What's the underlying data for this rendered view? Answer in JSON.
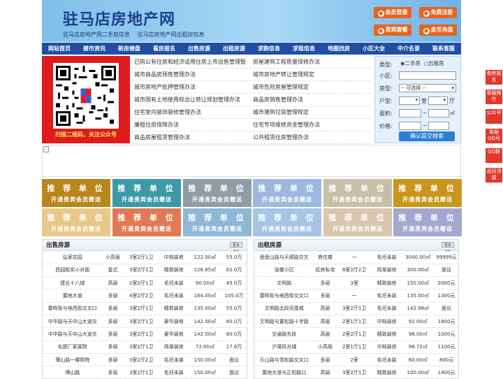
{
  "header": {
    "title": "驻马店房地产网",
    "subtitles": [
      "驻马店房地产网二手房信息",
      "驻马店房地产网出租房信息"
    ],
    "buttons": [
      {
        "label": "会员登录",
        "icon": "user-icon"
      },
      {
        "label": "免费注册",
        "icon": "register-icon"
      },
      {
        "label": "贵宾套餐",
        "icon": "vip-icon"
      },
      {
        "label": "金币充值",
        "icon": "coin-icon"
      }
    ]
  },
  "nav": [
    "网站首页",
    "楼市资讯",
    "新房楼盘",
    "看房报名",
    "出售房源",
    "出租房源",
    "求购信息",
    "求租信息",
    "地图找房",
    "小区大全",
    "中介名录",
    "联系客服"
  ],
  "qr": {
    "caption": "扫描二维码，关注公众号"
  },
  "links": [
    [
      "已购公有住房和经济适用住房上市出售管理暂",
      "房屋建筑工程质量保修办法"
    ],
    [
      "城市商品房预售管理办法",
      "城市房地产转让管理规定"
    ],
    [
      "城市房地产抵押管理办法",
      "城市危险房屋管理规定"
    ],
    [
      "城市国有土地使用权出让转让规划管理办法",
      "商品房销售管理办法"
    ],
    [
      "住宅室内装饰装修管理办法",
      "城市建筑垃圾管理规定"
    ],
    [
      "廉租住房保障办法",
      "住宅专项维修资金管理办法"
    ],
    [
      "商品房屋租赁管理办法",
      "公共租赁住房管理办法"
    ]
  ],
  "search": {
    "type_label": "类型:",
    "type_options": [
      "二手房",
      "出租房"
    ],
    "community_label": "小区:",
    "room_label": "房型:",
    "room_select": "-- 可选择 --",
    "layout_label": "户型:",
    "layout_unit1": "室",
    "layout_unit2": "厅",
    "area_label": "面积:",
    "area_unit": "㎡",
    "price_label": "价格:",
    "tilde": "~",
    "submit": "确认提交搜索"
  },
  "promo": {
    "title": "推 荐 单 位",
    "sub": "开通贵宾会员赠送",
    "colors": [
      "#b8861b",
      "#3a9aa8",
      "#8f9ea6",
      "#9db8e0",
      "#c9bfa9",
      "#c9961c",
      "#e8c88a",
      "#e07a55",
      "#8fb8d8",
      "#a7c4e6",
      "#d8c7ad",
      "#a3a8cf"
    ]
  },
  "sale": {
    "title": "出售房源",
    "more": "更多>>",
    "rows": [
      [
        "弘家花园",
        "小高层",
        "3室2厅1卫",
        "中档装修",
        "122.00㎡",
        "55.0万"
      ],
      [
        "西园街实小对面",
        "复式",
        "3室2厅2卫",
        "精致装修",
        "126.85㎡",
        "62.0万"
      ],
      [
        "建业十八城",
        "高层",
        "2室2厅1卫",
        "毛坯未装",
        "90.00㎡",
        "45.0万"
      ],
      [
        "置地大道",
        "多层",
        "4室2厅2卫",
        "毛坯未装",
        "164.00㎡",
        "105.0万"
      ],
      [
        "春晖街与电西街交叉口",
        "多层",
        "3室2厅1卫",
        "精致装修",
        "135.00㎡",
        "55.0万"
      ],
      [
        "中华路与天中山大道交",
        "多层",
        "3室2厅1卫",
        "豪华装修",
        "142.00㎡",
        "80.0万"
      ],
      [
        "中华路与天中山大道交",
        "多层",
        "3室2厅1卫",
        "豪华装修",
        "142.00㎡",
        "80.0万"
      ],
      [
        "化肥厂家属院",
        "多层",
        "3室2厅1卫",
        "简单装修",
        "72.00㎡",
        "17.8万"
      ],
      [
        "薄山路一棵帮院",
        "多层",
        "3室2厅2卫",
        "毛坯未装",
        "150.00㎡",
        "面议"
      ],
      [
        "博山路",
        "多层",
        "3室2厅1卫",
        "毛坯未装",
        "150.00㎡",
        "面议"
      ]
    ]
  },
  "rent": {
    "title": "出租房源",
    "more": "更多>>",
    "rows": [
      [
        "盘盘山路与天顺路交叉",
        "商住楼",
        "一",
        "毛坯未装",
        "3000.00㎡",
        "99999元"
      ],
      [
        "张楼小区",
        "民房私宅",
        "8室2厅2卫",
        "简单装修",
        "300.00㎡",
        "面议"
      ],
      [
        "文明路",
        "多层",
        "3室",
        "精致装修",
        "150.00㎡",
        "2000元"
      ],
      [
        "春晖街与电西街交叉口",
        "多层",
        "一",
        "毛坯未装",
        "135.00㎡",
        "1300元"
      ],
      [
        "文明路北段凤凰城",
        "高层",
        "3室2厅1卫",
        "毛坯未装",
        "142.98㎡",
        "面议"
      ],
      [
        "文明路与置松路十字路",
        "高层",
        "2室1厅1卫",
        "中档装修",
        "92.00㎡",
        "1800元"
      ],
      [
        "交通路东段",
        "高层",
        "2室2厅1卫",
        "精致装修",
        "98.00㎡",
        "1000元"
      ],
      [
        "沪蒲风光城",
        "小高层",
        "2室1厅1卫",
        "中档装修",
        "98.72㎡",
        "1100元"
      ],
      [
        "乐山路与雪松路交叉口",
        "多层",
        "2室",
        "毛坯未装",
        "60.00㎡",
        "800元"
      ],
      [
        "置地大道与正阳路口",
        "高层",
        "3室2厅1卫",
        "精致装修",
        "100.00㎡",
        "1400元"
      ]
    ]
  },
  "side": [
    "看房报名",
    "客服微信",
    "公众号",
    "客服QQ号",
    "QQ群",
    "返回顶部"
  ]
}
